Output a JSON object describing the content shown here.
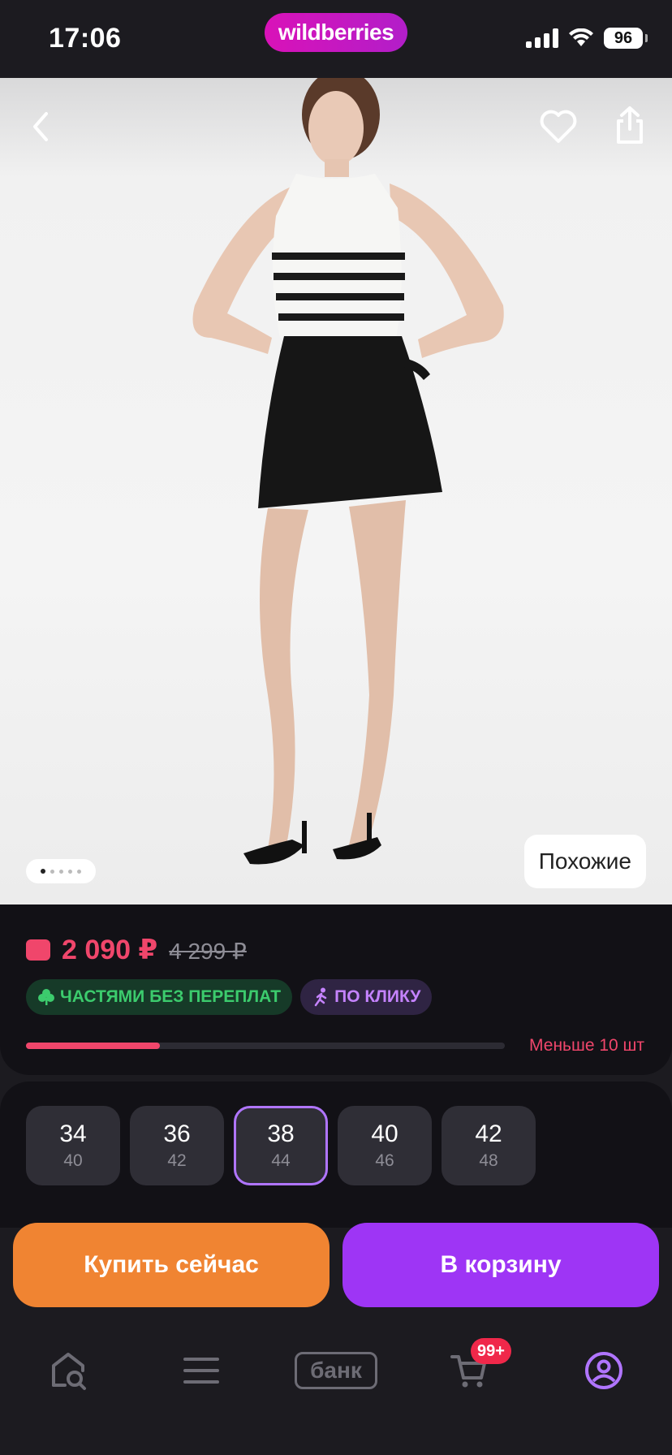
{
  "status_bar": {
    "time": "17:06",
    "battery": "96"
  },
  "brand": {
    "logo_text": "wildberries"
  },
  "hero": {
    "similar_label": "Похожие",
    "photo_count": 5,
    "current_photo": 1
  },
  "price": {
    "current": "2 090 ₽",
    "old": "4 299 ₽",
    "badge_installments": "ЧАСТЯМИ БЕЗ ПЕРЕПЛАТ",
    "badge_click": "ПО КЛИКУ",
    "stock_text": "Меньше 10 шт",
    "stock_level": 0.28
  },
  "sizes": {
    "items": [
      {
        "ru": "34",
        "int": "40"
      },
      {
        "ru": "36",
        "int": "42"
      },
      {
        "ru": "38",
        "int": "44"
      },
      {
        "ru": "40",
        "int": "46"
      },
      {
        "ru": "42",
        "int": "48"
      }
    ],
    "selected": "38"
  },
  "actions": {
    "buy_now": "Купить сейчас",
    "add_to_cart": "В корзину"
  },
  "bottom_nav": {
    "bank_label": "банк",
    "cart_badge": "99+"
  },
  "colors": {
    "accent": "#9e35f5",
    "buy": "#f08432",
    "price": "#f0466b",
    "brand": "#cb11ab"
  }
}
